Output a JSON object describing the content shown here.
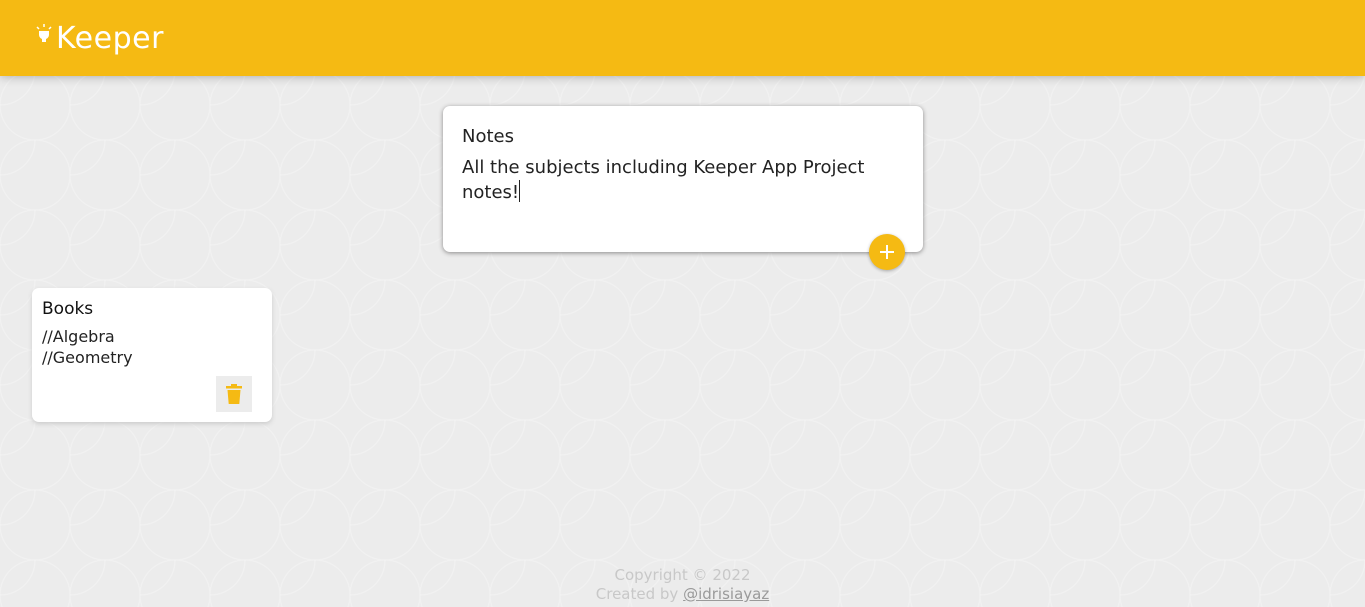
{
  "header": {
    "brand": "Keeper",
    "icon": "lightbulb-icon"
  },
  "create_note": {
    "title_value": "Notes",
    "content_value": "All the subjects including Keeper App Project notes!",
    "add_icon": "plus-icon"
  },
  "notes": [
    {
      "title": "Books",
      "lines": [
        "//Algebra",
        "//Geometry"
      ],
      "delete_icon": "trash-icon"
    }
  ],
  "footer": {
    "copyright": "Copyright © 2022",
    "created_by": "Created by",
    "author": "@idrisiayaz"
  },
  "colors": {
    "accent": "#f5ba13",
    "background": "#ececec"
  }
}
